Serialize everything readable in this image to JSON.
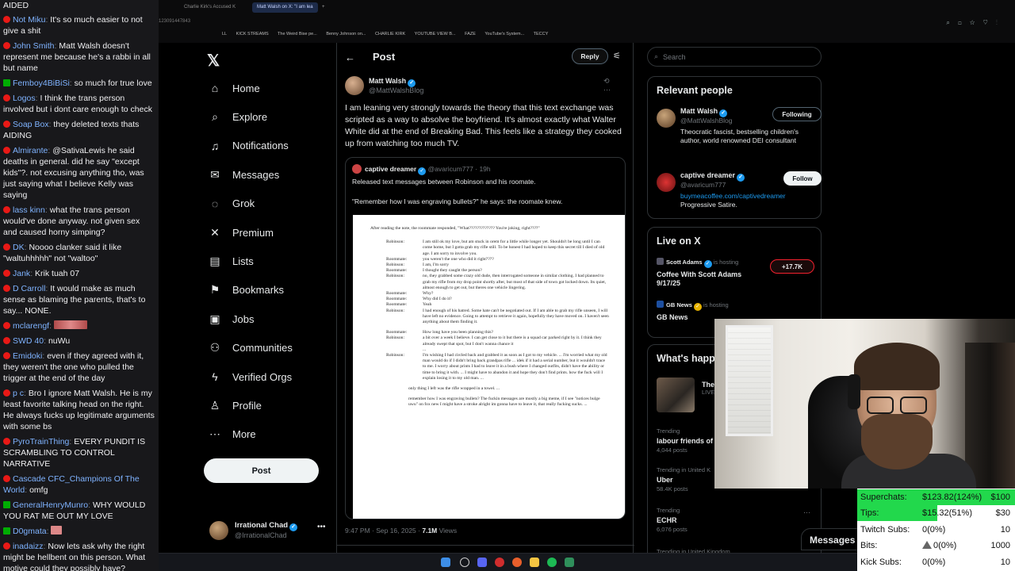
{
  "chat": {
    "top_line": "AIDED",
    "messages": [
      {
        "user": "Not Miku",
        "color": "#7fb3ff",
        "badge": "red",
        "text": "It's so much easier to not give a shit"
      },
      {
        "user": "John Smith",
        "color": "#7fb3ff",
        "badge": "red",
        "text": "Matt Walsh doesn't represent me because he's a rabbi in all but name"
      },
      {
        "user": "Femboy4BiBiSi",
        "color": "#7fb3ff",
        "badge": "green",
        "text": "so much for true love"
      },
      {
        "user": "Logos",
        "color": "#7fb3ff",
        "badge": "red",
        "text": "I think the trans person involved but i dont care enough to check"
      },
      {
        "user": "Soap Box",
        "color": "#7fb3ff",
        "badge": "red",
        "text": "they deleted texts thats AIDING"
      },
      {
        "user": "Almirante",
        "color": "#7fb3ff",
        "badge": "red",
        "text": "@SativaLewis he said deaths in general. did he say \"except kids\"?. not excusing anything tho, was just saying what I believe Kelly was saying"
      },
      {
        "user": "lass kinn",
        "color": "#7fb3ff",
        "badge": "red",
        "text": "what the trans person would've done anyway. not given sex and caused horny simping?"
      },
      {
        "user": "DK",
        "color": "#7fb3ff",
        "badge": "red",
        "text": "Noooo clanker said it like \"waltuhhhhh\" not \"waltoo\""
      },
      {
        "user": "Jank",
        "color": "#7fb3ff",
        "badge": "red",
        "text": "Krik tuah 07"
      },
      {
        "user": "D Carroll",
        "color": "#7fb3ff",
        "badge": "red",
        "text": "It would make as much sense as blaming the parents, that's to say... NONE."
      },
      {
        "user": "mclarengf",
        "color": "#7fb3ff",
        "badge": "red",
        "text": "",
        "emote": true
      },
      {
        "user": "SWD 40",
        "color": "#7fb3ff",
        "badge": "red",
        "text": "nuWu"
      },
      {
        "user": "Emidoki",
        "color": "#7fb3ff",
        "badge": "red",
        "text": "even if they agreed with it, they weren't the one who pulled the trigger at the end of the day"
      },
      {
        "user": "p c",
        "color": "#7fb3ff",
        "badge": "red",
        "text": "Bro I ignore Matt Walsh. He is my least favorite talking head on the right. He always fucks up legitimate arguments with some bs"
      },
      {
        "user": "PyroTrainThing",
        "color": "#7fb3ff",
        "badge": "red",
        "text": "EVERY PUNDIT IS SCRAMBLING TO CONTROL NARRATIVE"
      },
      {
        "user": "Cascade CFC_Champions Of The World",
        "color": "#7fb3ff",
        "badge": "red",
        "text": "omfg"
      },
      {
        "user": "GeneralHenryMunro",
        "color": "#7fb3ff",
        "badge": "green",
        "text": "WHY WOULD YOU RAT ME OUT MY LOVE"
      },
      {
        "user": "D0gmata",
        "color": "#7fb3ff",
        "badge": "green",
        "text": "",
        "emote_small": true
      },
      {
        "user": "inadaizz",
        "color": "#7fb3ff",
        "badge": "red",
        "text": "Now lets ask why the right might be hellbent on this person. What motive could they possibly have?"
      }
    ]
  },
  "browser": {
    "tabs": [
      {
        "label": "Charlie Kirk's Accused K",
        "active": false
      },
      {
        "label": "Matt Walsh on X: \"I am lea",
        "active": true
      }
    ],
    "address_fragment": "123091447843",
    "bookmarks": [
      "LL",
      "KICK STREAMS",
      "The Weird Bise pe...",
      "Benny Johnson on...",
      "CHARLIE KIRK",
      "YOUTUBE VIEW B...",
      "FAZE",
      "YouTube's System...",
      "TECCY"
    ]
  },
  "nav": {
    "items": [
      {
        "label": "Home",
        "icon": "home-icon",
        "glyph": "⌂"
      },
      {
        "label": "Explore",
        "icon": "search-icon",
        "glyph": "⌕"
      },
      {
        "label": "Notifications",
        "icon": "bell-icon",
        "glyph": "♫"
      },
      {
        "label": "Messages",
        "icon": "envelope-icon",
        "glyph": "✉"
      },
      {
        "label": "Grok",
        "icon": "grok-icon",
        "glyph": "◌"
      },
      {
        "label": "Premium",
        "icon": "x-logo-icon",
        "glyph": "✕"
      },
      {
        "label": "Lists",
        "icon": "list-icon",
        "glyph": "▤"
      },
      {
        "label": "Bookmarks",
        "icon": "bookmark-icon",
        "glyph": "⚑"
      },
      {
        "label": "Jobs",
        "icon": "briefcase-icon",
        "glyph": "▣"
      },
      {
        "label": "Communities",
        "icon": "people-icon",
        "glyph": "⚇"
      },
      {
        "label": "Verified Orgs",
        "icon": "lightning-icon",
        "glyph": "ϟ"
      },
      {
        "label": "Profile",
        "icon": "person-icon",
        "glyph": "♙"
      },
      {
        "label": "More",
        "icon": "more-circle-icon",
        "glyph": "⋯"
      }
    ],
    "post_label": "Post",
    "account_name": "Irrational Chad",
    "account_handle": "@IrrationalChad"
  },
  "post": {
    "header_title": "Post",
    "reply_label": "Reply",
    "author_name": "Matt Walsh",
    "author_handle": "@MattWalshBlog",
    "text": "I am leaning very strongly towards the theory that this text exchange was scripted as a way to absolve the boyfriend. It's almost exactly what Walter White did at the end of Breaking Bad. This feels like a strategy they cooked up from watching too much TV.",
    "quote": {
      "name": "captive dreamer",
      "handle": "@avaricum777",
      "time": "· 19h",
      "line1": "Released text messages between Robinson and his roomate.",
      "line2": "\"Remember how I was engraving bullets?\" he says: the roomate knew.",
      "doc_intro": "After reading the note, the roommate responded, \"What????????????? You're joking, right????\"",
      "doc_lines": [
        {
          "s": "Robinson:",
          "t": "I am still ok my love, but am stuck in orem for a little while longer yet. Shouldn't be long until I can come home, but I gotta grab my rifle still. To be honest I had hoped to keep this secret till I died of old age. I am sorry to involve you."
        },
        {
          "s": "Roommate:",
          "t": "you weren't the one who did it right????"
        },
        {
          "s": "Robinson:",
          "t": "I am, I'm sorry"
        },
        {
          "s": "Roommate:",
          "t": "I thought they caught the person?"
        },
        {
          "s": "Robinson:",
          "t": "no, they grabbed some crazy old dude, then interrogated someone in similar clothing. I had planned to grab my rifle from my drop point shortly after, but most of that side of town got locked down. Its quiet, almost enough to get out, but theres one vehicle lingering."
        },
        {
          "s": "Roommate:",
          "t": "Why?"
        },
        {
          "s": "Roommate:",
          "t": "Why did I do it?"
        },
        {
          "s": "Roommate:",
          "t": "Yeah"
        },
        {
          "s": "Robinson:",
          "t": "I had enough of his hatred. Some hate can't be negotiated out. If I am able to grab my rifle unseen, I will have left no evidence. Going to attempt to retrieve it again, hopefully they have moved on. I haven't seen anything about them finding it."
        },
        {
          "s": "",
          "t": ""
        },
        {
          "s": "Roommate:",
          "t": "How long have you been planning this?"
        },
        {
          "s": "Robinson:",
          "t": "a bit over a week I believe. I can get close to it but there is a squad car parked right by it. I think they already swept that spot, but I don't wanna chance it"
        },
        {
          "s": "",
          "t": "..."
        },
        {
          "s": "Robinson:",
          "t": "I'm wishing I had circled back and grabbed it as soon as I got to my vehicle. ... I'm worried what my old man would do if I didn't bring back grandpas rifle ... idek if it had a serial number, but it wouldn't trace to me. I worry about prints I had to leave it in a bush where I changed outfits, didn't have the ability or time to bring it with. ... I might have to abandon it and hope they don't find prints. how the fuck will I explain losing it to my old man. ..."
        }
      ],
      "doc_mid": "only thing I left was the rifle wrapped in a towel. ...",
      "doc_end": "remember how I was engraving bullets? The fuckin messages are mostly a big meme, if I see \"notices bulge uwu\" on fox new I might have a stroke alright im gonna have to leave it, that really fucking sucks. ..."
    },
    "time": "9:47 PM · Sep 16, 2025 ·",
    "views_count": "7.1M",
    "views_label": "Views"
  },
  "sidebar": {
    "search_placeholder": "Search",
    "relevant_title": "Relevant people",
    "people": [
      {
        "name": "Matt Walsh",
        "handle": "@MattWalshBlog",
        "bio": "Theocratic fascist, bestselling children's author, world renowned DEI consultant",
        "link": "",
        "button": "Following"
      },
      {
        "name": "captive dreamer",
        "handle": "@avaricum777",
        "bio": "Progressive Satire.",
        "link": "buymeacoffee.com/captivedreamer",
        "button": "Follow"
      }
    ],
    "live_title": "Live on X",
    "live": [
      {
        "host": "Scott Adams",
        "status": "is hosting",
        "title": "Coffee With Scott Adams 9/17/25",
        "count": "+17.7K"
      },
      {
        "host": "GB News",
        "status": "is hosting",
        "title": "GB News",
        "count": ""
      }
    ],
    "happening_title": "What's happ",
    "trend_featured": {
      "title": "The",
      "sub": "LIVE"
    },
    "trends": [
      {
        "context": "Trending",
        "title": "labour friends of",
        "posts": "4,044 posts"
      },
      {
        "context": "Trending in United K",
        "title": "Uber",
        "posts": "58.4K posts"
      },
      {
        "context": "Trending",
        "title": "ECHR",
        "posts": "6,076 posts"
      },
      {
        "context": "Trending in United Kingdom",
        "title": "",
        "posts": ""
      }
    ],
    "messages_label": "Messages"
  },
  "goals": [
    {
      "label": "Superchats:",
      "current": "$123.82(124%)",
      "target": "$100",
      "fill": 1.0
    },
    {
      "label": "Tips:",
      "current": "$15.32(51%)",
      "target": "$30",
      "fill": 0.51
    },
    {
      "label": "Twitch Subs:",
      "current": "0(0%)",
      "target": "10",
      "fill": 0
    },
    {
      "label": "Bits:",
      "current": "0(0%)",
      "target": "1000",
      "fill": 0
    },
    {
      "label": "Kick Subs:",
      "current": "0(0%)",
      "target": "10",
      "fill": 0
    }
  ],
  "colors": {
    "accent": "#1d9bf0",
    "goal_fill": "#22d84c",
    "badge_red": "#e91916",
    "badge_green": "#00ad03"
  }
}
